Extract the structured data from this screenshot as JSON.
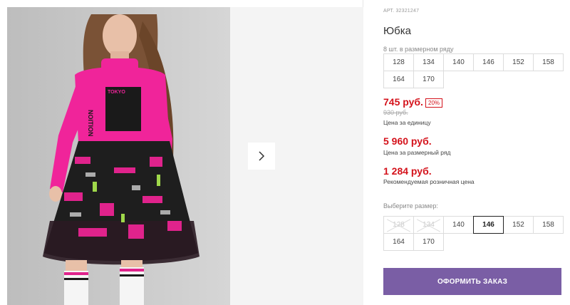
{
  "product": {
    "article_label": "АРТ.",
    "article": "32321247",
    "title": "Юбка",
    "size_row_label": "8 шт. в размерном ряду",
    "size_row": [
      "128",
      "134",
      "140",
      "146",
      "152",
      "158",
      "164",
      "170"
    ],
    "unit_price": "745 руб.",
    "discount": "20%",
    "old_price": "930 руб.",
    "unit_price_label": "Цена за единицу",
    "row_price": "5 960 руб.",
    "row_price_label": "Цена за размерный ряд",
    "retail_price": "1 284 руб.",
    "retail_price_label": "Рекомендуемая розничная цена",
    "choose_size_label": "Выберите размер:",
    "sizes": [
      {
        "label": "128",
        "state": "disabled"
      },
      {
        "label": "134",
        "state": "disabled"
      },
      {
        "label": "140",
        "state": "available"
      },
      {
        "label": "146",
        "state": "selected"
      },
      {
        "label": "152",
        "state": "available"
      },
      {
        "label": "158",
        "state": "available"
      },
      {
        "label": "164",
        "state": "available"
      },
      {
        "label": "170",
        "state": "available"
      }
    ],
    "order_button": "ОФОРМИТЬ ЗАКАЗ"
  },
  "gallery": {
    "next_icon": "chevron-right-icon",
    "photo_texts": [
      "TOKYO",
      "TOKYO",
      "NOITION"
    ]
  },
  "colors": {
    "price_red": "#d4121b",
    "order_purple": "#7a5ea5",
    "turtleneck_pink": "#f0249a"
  }
}
